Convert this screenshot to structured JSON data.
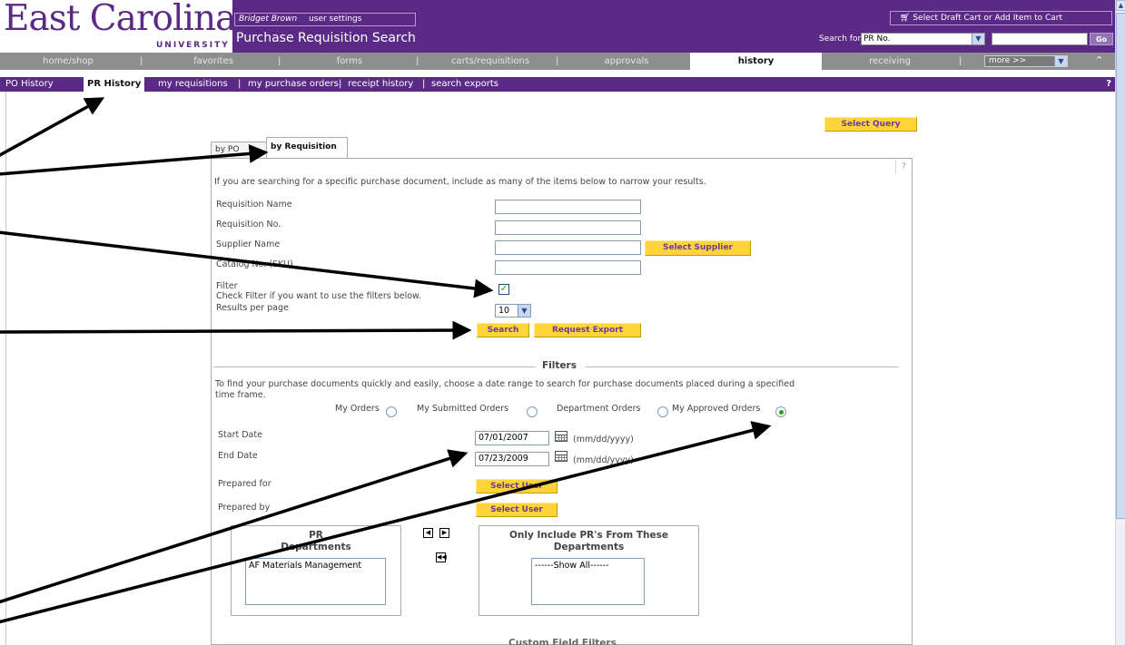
{
  "header": {
    "logo_name": "East Carolina",
    "logo_sub": "UNIVERSITY",
    "user_name": "Bridget Brown",
    "user_settings": "user settings",
    "page_title": "Purchase Requisition Search",
    "cart_label": "Select Draft Cart or Add Item to Cart",
    "search_for_label": "Search for",
    "search_for_value": "PR No.",
    "go_label": "Go"
  },
  "main_nav": {
    "items": [
      "home/shop",
      "favorites",
      "forms",
      "carts/requisitions",
      "approvals",
      "history",
      "receiving"
    ],
    "active": "history",
    "more_label": "more >>"
  },
  "sub_nav": {
    "items": [
      "PO History",
      "PR History",
      "my requisitions",
      "my purchase orders",
      "receipt history",
      "search exports"
    ],
    "active": "PR History",
    "help": "?"
  },
  "content": {
    "select_query": "Select Query",
    "tab_po": "by PO",
    "tab_req": "by Requisition",
    "help_q": "?",
    "intro": "If you are searching for a specific purchase document, include as many of the items below to narrow your results.",
    "req_name_label": "Requisition Name",
    "req_no_label": "Requisition No.",
    "supplier_label": "Supplier Name",
    "select_supplier": "Select Supplier",
    "catalog_label": "Catalog No. (SKU)",
    "filter_label": "Filter",
    "filter_hint": "Check Filter if you want to use the filters below.",
    "filter_checked": true,
    "results_label": "Results per page",
    "results_value": "10",
    "search_btn": "Search",
    "export_btn": "Request Export"
  },
  "filters": {
    "heading": "Filters",
    "intro_line1": "To find your purchase documents quickly and easily, choose a date range to search for purchase documents placed during a specified",
    "intro_line2": "time frame.",
    "radios": [
      "My Orders",
      "My Submitted Orders",
      "Department Orders",
      "My Approved Orders"
    ],
    "selected_radio": "My Approved Orders",
    "start_label": "Start Date",
    "start_value": "07/01/2007",
    "end_label": "End Date",
    "end_value": "07/23/2009",
    "date_format": "(mm/dd/yyyy)",
    "prepared_for_label": "Prepared for",
    "prepared_by_label": "Prepared by",
    "select_user": "Select User",
    "pr_depts_title_line1": "PR",
    "pr_depts_title_line2": "Departments",
    "pr_depts_items": [
      "AF Materials Management"
    ],
    "only_include_line1": "Only Include PR's From These",
    "only_include_line2": "Departments",
    "only_include_items": [
      "------Show All------"
    ],
    "custom_field_heading": "Custom Field Filters"
  }
}
